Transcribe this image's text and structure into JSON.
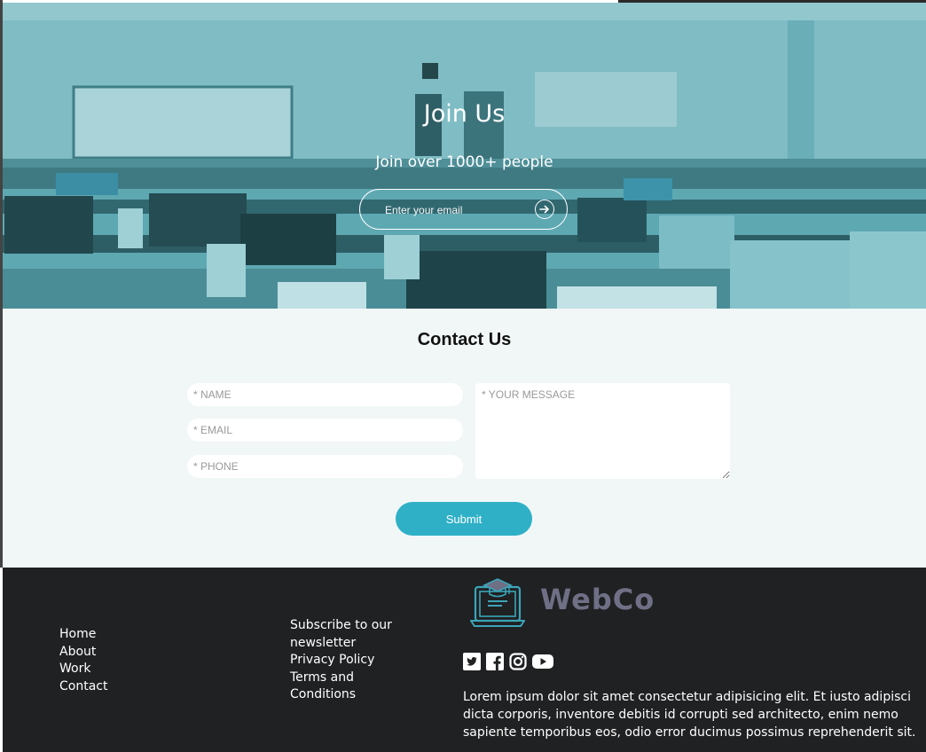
{
  "hero": {
    "title": "Join Us",
    "subtitle": "Join over 1000+ people",
    "email_placeholder": "Enter your email",
    "submit_icon": "arrow-right-circle-icon"
  },
  "contact": {
    "title": "Contact Us",
    "name_placeholder": "* NAME",
    "email_placeholder": "* EMAIL",
    "phone_placeholder": "* PHONE",
    "message_placeholder": "* YOUR MESSAGE",
    "submit_label": "Submit"
  },
  "footer": {
    "nav_links": [
      "Home",
      "About",
      "Work",
      "Contact"
    ],
    "secondary_links": [
      "Subscribe to our newsletter",
      "Privacy Policy",
      "Terms and Conditions"
    ],
    "brand": "WebCo",
    "socials": [
      "twitter-icon",
      "facebook-icon",
      "instagram-icon",
      "youtube-icon"
    ],
    "about": "Lorem ipsum dolor sit amet consectetur adipisicing elit. Et iusto adipisci dicta corporis, inventore debitis id corrupti sed architecto, enim nemo sapiente temporibus eos, odio error ducimus possimus reprehenderit sit."
  },
  "colors": {
    "hero_tint": "#5fa9b3",
    "contact_bg": "#f1f7f7",
    "accent": "#2fb0c7",
    "footer_bg": "#202123",
    "brand_text": "#6f6f86"
  }
}
